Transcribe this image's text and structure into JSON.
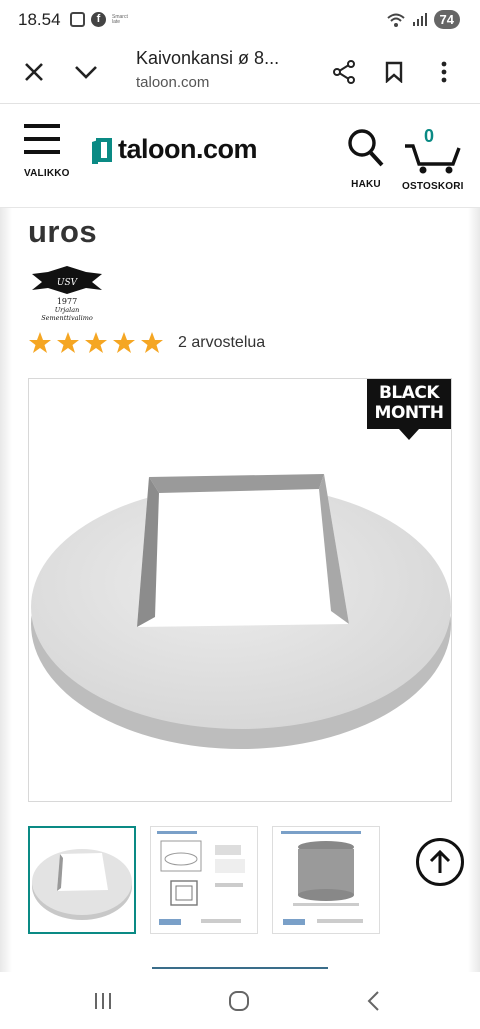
{
  "status": {
    "time": "18.54",
    "tiny_label": "Smarct\nlate",
    "battery": "74"
  },
  "browser": {
    "tab_title": "Kaivonkansi ø 8...",
    "host": "taloon.com"
  },
  "site": {
    "menu_label": "VALIKKO",
    "logo_text": "taloon.com",
    "search_label": "HAKU",
    "cart_label": "OSTOSKORI",
    "cart_count": "0"
  },
  "product": {
    "title": "uros",
    "brand_logo_text": "1977 Urjalan Sementtivalimo",
    "stars": 5,
    "reviews": "2 arvostelua",
    "badge_line1": "BLACK",
    "badge_line2": "MONTH"
  },
  "colors": {
    "accent": "#0a8a84",
    "star": "#f5a623"
  }
}
